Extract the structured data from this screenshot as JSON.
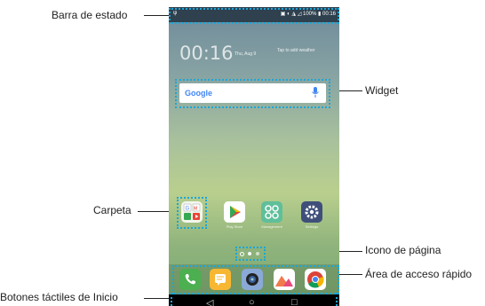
{
  "callouts": {
    "status_bar": "Barra de estado",
    "widget": "Widget",
    "folder": "Carpeta",
    "page_icon": "Icono de página",
    "quick_access": "Área de acceso rápido",
    "home_touch_buttons": "Botones táctiles de Inicio"
  },
  "phone": {
    "status_right": "100%",
    "status_time": "00:16",
    "clock": "00:16",
    "date": "Thu, Aug 9",
    "weather_hint": "Tap to add weather",
    "search_logo": "Google",
    "apps": [
      {
        "label": "Play Store",
        "icon": "play-store-icon"
      },
      {
        "label": "Management",
        "icon": "management-icon"
      },
      {
        "label": "Settings",
        "icon": "settings-icon"
      }
    ],
    "dock": [
      "phone-icon",
      "messages-icon",
      "camera-icon",
      "gallery-icon",
      "chrome-icon"
    ],
    "nav": {
      "back": "◁",
      "home": "○",
      "recent": "□"
    }
  },
  "colors": {
    "highlight": "#1aa6d8",
    "status_bar": "#283746",
    "navbar": "#000000"
  }
}
